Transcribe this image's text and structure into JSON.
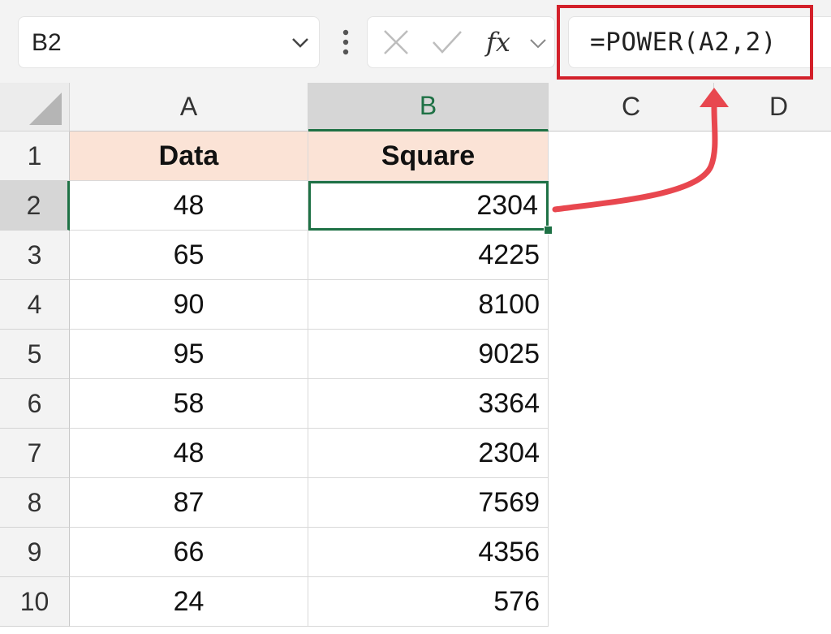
{
  "name_box": {
    "value": "B2",
    "icon": "chevron-down-icon"
  },
  "formula_bar": {
    "cancel_icon": "x-icon",
    "enter_icon": "check-icon",
    "fx_label": "fx",
    "formula": "=POWER(A2,2)",
    "highlight_color": "#d3202a"
  },
  "columns": [
    "A",
    "B",
    "C",
    "D"
  ],
  "rows": [
    "1",
    "2",
    "3",
    "4",
    "5",
    "6",
    "7",
    "8",
    "9",
    "10"
  ],
  "active_cell": "B2",
  "table": {
    "headers": [
      "Data",
      "Square"
    ],
    "header_fill": "#fbe3d6",
    "data": [
      [
        "48",
        "2304"
      ],
      [
        "65",
        "4225"
      ],
      [
        "90",
        "8100"
      ],
      [
        "95",
        "9025"
      ],
      [
        "58",
        "3364"
      ],
      [
        "48",
        "2304"
      ],
      [
        "87",
        "7569"
      ],
      [
        "66",
        "4356"
      ],
      [
        "24",
        "576"
      ]
    ]
  },
  "colors": {
    "selection": "#1e7145",
    "annotation_arrow": "#e8474f"
  }
}
